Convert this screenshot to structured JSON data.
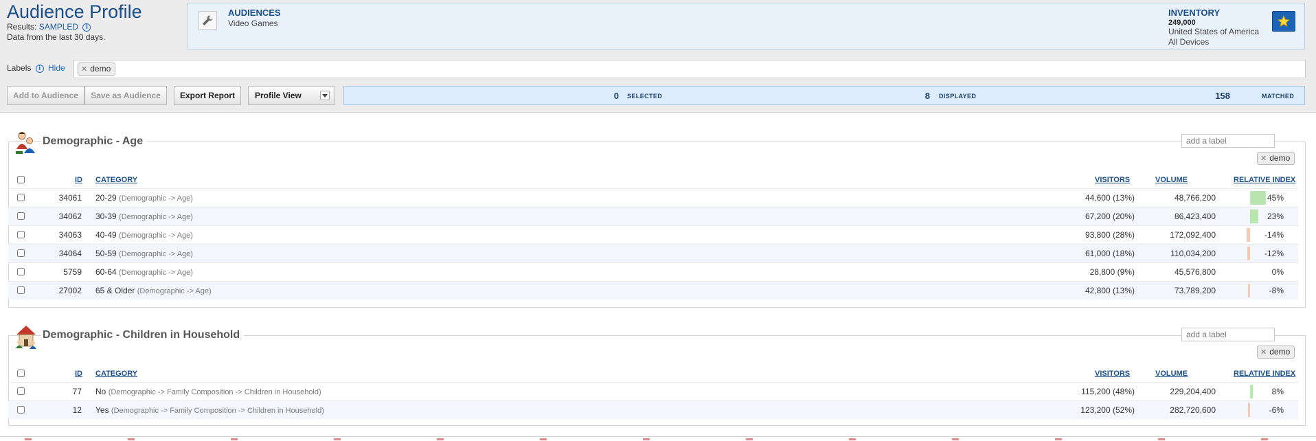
{
  "header": {
    "title": "Audience Profile",
    "results_label": "Results:",
    "results_value": "SAMPLED",
    "date_note": "Data from the last 30 days."
  },
  "summary": {
    "audiences_title": "AUDIENCES",
    "audiences_value": "Video Games",
    "inventory_title": "INVENTORY",
    "inventory_count": "249,000",
    "inventory_country": "United States of America",
    "inventory_devices": "All Devices"
  },
  "labels": {
    "label": "Labels",
    "hide": "Hide",
    "tags": [
      "demo"
    ]
  },
  "toolbar": {
    "add_to_audience": "Add to Audience",
    "save_as_audience": "Save as Audience",
    "export_report": "Export Report",
    "profile_view": "Profile View",
    "selected_count": "0",
    "selected_label": "SELECTED",
    "displayed_count": "8",
    "displayed_label": "DISPLAYED",
    "matched_count": "158",
    "matched_label": "MATCHED"
  },
  "columns": {
    "id": "ID",
    "category": "CATEGORY",
    "visitors": "VISITORS",
    "volume": "VOLUME",
    "relative_index": "RELATIVE INDEX"
  },
  "colors": {
    "positive_bar": "#b9e6b0",
    "negative_bar": "#f6c9b5",
    "accent": "#1a4f8c"
  },
  "sections": [
    {
      "title": "Demographic - Age",
      "icon": "people-icon",
      "add_label_placeholder": "add a label",
      "tag": "demo",
      "rows": [
        {
          "id": "34061",
          "name": "20-29",
          "path": "(Demographic -> Age)",
          "visitors": "44,600 (13%)",
          "volume": "48,766,200",
          "index": "45%",
          "index_value": 45
        },
        {
          "id": "34062",
          "name": "30-39",
          "path": "(Demographic -> Age)",
          "visitors": "67,200 (20%)",
          "volume": "86,423,400",
          "index": "23%",
          "index_value": 23
        },
        {
          "id": "34063",
          "name": "40-49",
          "path": "(Demographic -> Age)",
          "visitors": "93,800 (28%)",
          "volume": "172,092,400",
          "index": "-14%",
          "index_value": -14
        },
        {
          "id": "34064",
          "name": "50-59",
          "path": "(Demographic -> Age)",
          "visitors": "61,000 (18%)",
          "volume": "110,034,200",
          "index": "-12%",
          "index_value": -12
        },
        {
          "id": "5759",
          "name": "60-64",
          "path": "(Demographic -> Age)",
          "visitors": "28,800 (9%)",
          "volume": "45,576,800",
          "index": "0%",
          "index_value": 0
        },
        {
          "id": "27002",
          "name": "65 & Older",
          "path": "(Demographic -> Age)",
          "visitors": "42,800 (13%)",
          "volume": "73,789,200",
          "index": "-8%",
          "index_value": -8
        }
      ]
    },
    {
      "title": "Demographic - Children in Household",
      "icon": "house-icon",
      "add_label_placeholder": "add a label",
      "tag": "demo",
      "rows": [
        {
          "id": "77",
          "name": "No",
          "path": "(Demographic -> Family Composition -> Children in Household)",
          "visitors": "115,200 (48%)",
          "volume": "229,204,400",
          "index": "8%",
          "index_value": 8
        },
        {
          "id": "12",
          "name": "Yes",
          "path": "(Demographic -> Family Composition -> Children in Household)",
          "visitors": "123,200 (52%)",
          "volume": "282,720,600",
          "index": "-6%",
          "index_value": -6
        }
      ]
    }
  ]
}
